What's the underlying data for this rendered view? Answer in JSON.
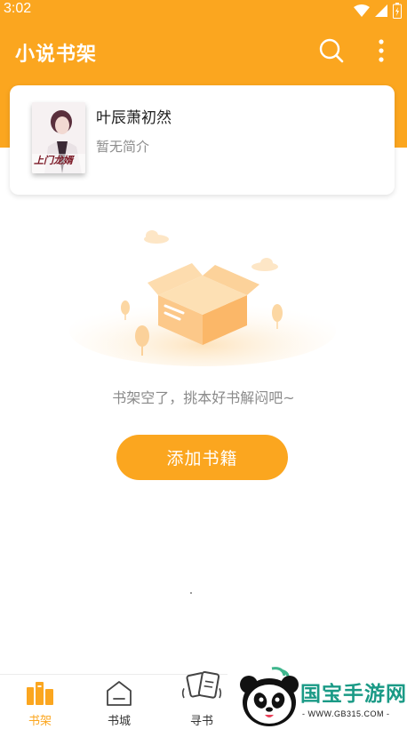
{
  "status_bar": {
    "time": "3:02",
    "icons": [
      "wifi-icon",
      "signal-icon",
      "battery-icon"
    ]
  },
  "header": {
    "title": "小说书架",
    "search_icon": "search-icon",
    "more_icon": "more-vertical-icon"
  },
  "book": {
    "title": "叶辰萧初然",
    "intro": "暂无简介",
    "cover_text": "上门龙婿"
  },
  "empty_state": {
    "message": "书架空了，挑本好书解闷吧~",
    "illustration": "empty-box-illustration"
  },
  "add_button": {
    "label": "添加书籍"
  },
  "bottom_nav": {
    "items": [
      {
        "label": "书架",
        "icon": "bookshelf-icon",
        "active": true
      },
      {
        "label": "书城",
        "icon": "bookstore-icon",
        "active": false
      },
      {
        "label": "寻书",
        "icon": "find-book-icon",
        "active": false
      }
    ]
  },
  "watermark": {
    "text": "国宝手游网",
    "url": "- WWW.GB315.COM -",
    "logo": "panda-logo-icon"
  },
  "colors": {
    "accent": "#fba61f",
    "text_secondary": "#8a8a8a",
    "watermark_green": "#1a9a86"
  }
}
